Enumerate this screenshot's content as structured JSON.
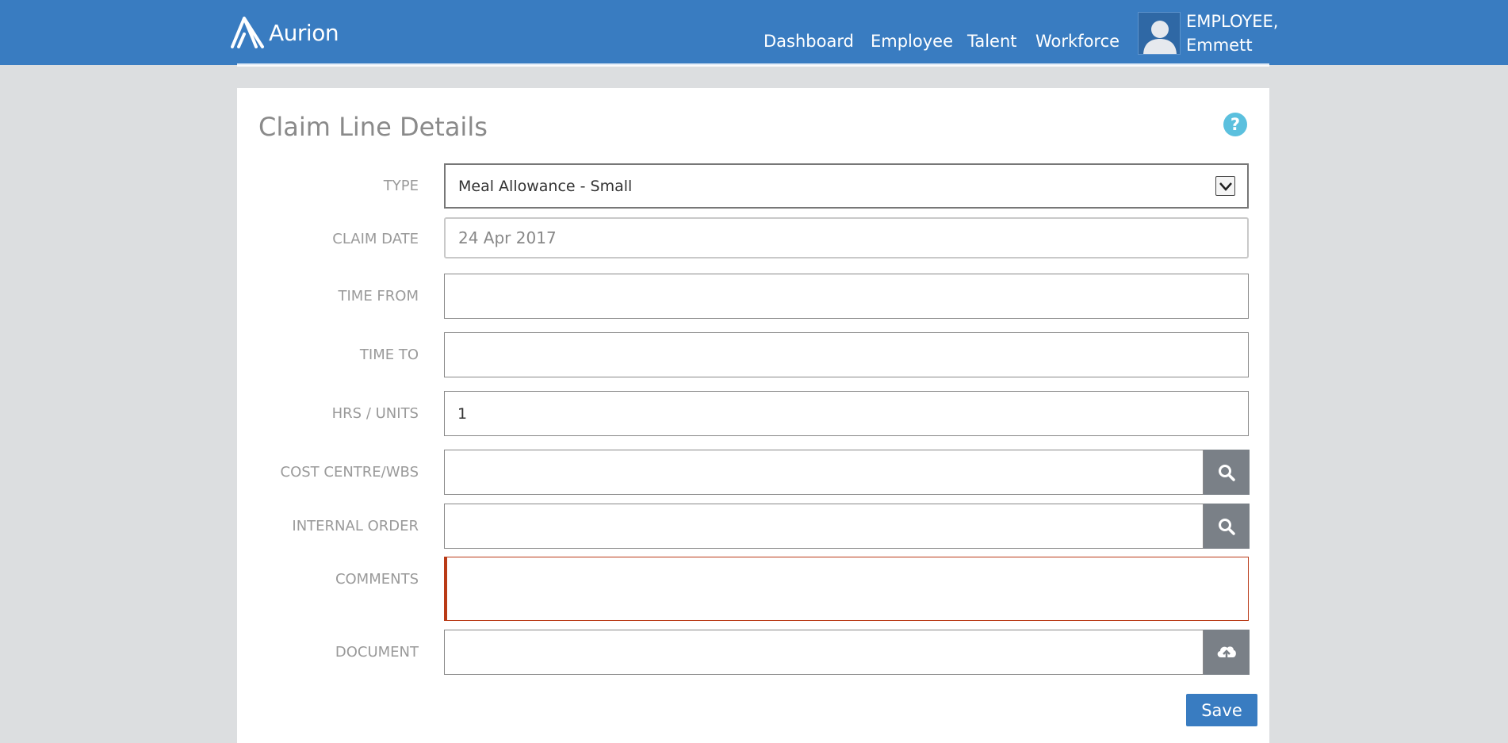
{
  "app": {
    "brand": "Aurion"
  },
  "nav": {
    "items": [
      "Dashboard",
      "Employee",
      "Talent",
      "Workforce"
    ]
  },
  "user": {
    "line1": "EMPLOYEE,",
    "line2": "Emmett"
  },
  "page": {
    "title": "Claim Line Details",
    "help": "?"
  },
  "form": {
    "type": {
      "label": "TYPE",
      "value": "Meal Allowance - Small"
    },
    "claim_date": {
      "label": "CLAIM DATE",
      "value": "24 Apr 2017"
    },
    "time_from": {
      "label": "TIME FROM",
      "value": ""
    },
    "time_to": {
      "label": "TIME TO",
      "value": ""
    },
    "hrs_units": {
      "label": "HRS / UNITS",
      "value": "1"
    },
    "cost_centre": {
      "label": "COST CENTRE/WBS",
      "value": ""
    },
    "internal_order": {
      "label": "INTERNAL ORDER",
      "value": ""
    },
    "comments": {
      "label": "COMMENTS",
      "value": ""
    },
    "document": {
      "label": "DOCUMENT",
      "value": ""
    }
  },
  "actions": {
    "save": "Save"
  },
  "icons": {
    "help": "help-icon",
    "dropdown": "chevron-down-icon",
    "search": "search-icon",
    "upload": "cloud-upload-icon",
    "avatar": "user-avatar-icon"
  },
  "colors": {
    "header": "#397cc1",
    "error": "#b93a16",
    "help": "#5bc0de",
    "side_button": "#7a8087"
  }
}
